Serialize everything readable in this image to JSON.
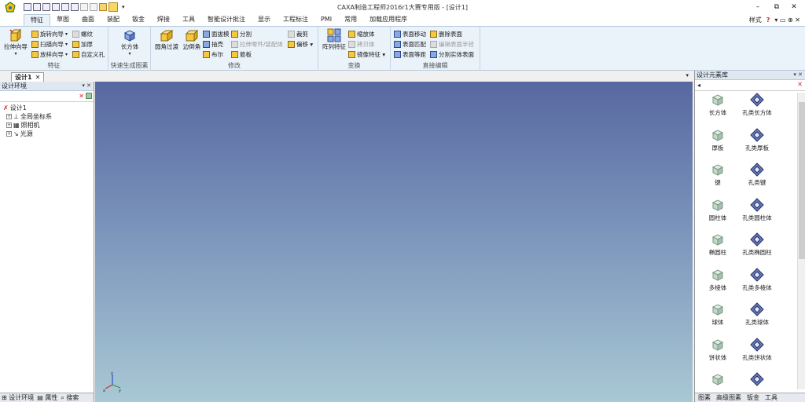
{
  "title": "CAXA制造工程师2016r1大赛专用版 - [设计1]",
  "window_controls": {
    "minimize": "–",
    "maximize": "⧉",
    "close": "✕"
  },
  "menu_tabs": [
    "特征",
    "草图",
    "曲面",
    "装配",
    "钣金",
    "焊接",
    "工具",
    "智能设计批注",
    "显示",
    "工程标注",
    "PMI",
    "常用",
    "加载应用程序"
  ],
  "menu_right": {
    "style": "样式",
    "help": "?",
    "extras": "▾ ▭ ⊕ ✕"
  },
  "ribbon": {
    "group_feature": {
      "label": "特征",
      "big": "拉伸向导",
      "b1": "旋转向导",
      "b2": "扫描向导",
      "b3": "放样向导",
      "c1": "螺纹",
      "c2": "加厚",
      "c3": "自定义孔"
    },
    "group_quick": {
      "label": "快速生成图素",
      "big": "长方体"
    },
    "group_modify": {
      "label": "修改",
      "big1": "圆角过渡",
      "big2": "边倒角",
      "a1": "面拔模",
      "a2": "抽壳",
      "a3": "布尔",
      "b1": "分割",
      "b2": "拉伸零件/装配体",
      "b3": "筋板",
      "c1": "裁剪",
      "c2": "偏移 ▾"
    },
    "group_transform": {
      "label": "变换",
      "big": "阵列特征",
      "a1": "缩放体",
      "a2": "拷贝体",
      "a3": "镜像特征 ▾"
    },
    "group_direct": {
      "label": "直接编辑",
      "a1": "表面移动",
      "a2": "表面匹配",
      "a3": "表面等距",
      "b1": "删除表面",
      "b2": "编辑表面半径",
      "b3": "分割实体表面"
    }
  },
  "doc_tab": "设计1",
  "left_panel": {
    "title": "设计环境",
    "tree": {
      "root": "设计1",
      "c1": "全局坐标系",
      "c2": "照相机",
      "c3": "光源"
    },
    "bottom": {
      "t1": "设计环境",
      "t2": "属性",
      "t3": "搜索"
    }
  },
  "right_panel": {
    "title": "设计元素库",
    "items": [
      {
        "label": "长方体",
        "icon": "cube-icon"
      },
      {
        "label": "孔类长方体",
        "icon": "hole-cube-icon"
      },
      {
        "label": "厚板",
        "icon": "plate-icon"
      },
      {
        "label": "孔类厚板",
        "icon": "hole-plate-icon"
      },
      {
        "label": "键",
        "icon": "key-icon"
      },
      {
        "label": "孔类键",
        "icon": "hole-key-icon"
      },
      {
        "label": "圆柱体",
        "icon": "cylinder-icon"
      },
      {
        "label": "孔类圆柱体",
        "icon": "hole-cylinder-icon"
      },
      {
        "label": "椭圆柱",
        "icon": "ellipse-cylinder-icon"
      },
      {
        "label": "孔类椭圆柱",
        "icon": "hole-ellipse-cylinder-icon"
      },
      {
        "label": "多棱体",
        "icon": "prism-icon"
      },
      {
        "label": "孔类多棱体",
        "icon": "hole-prism-icon"
      },
      {
        "label": "球体",
        "icon": "sphere-icon"
      },
      {
        "label": "孔类球体",
        "icon": "hole-sphere-icon"
      },
      {
        "label": "饼状体",
        "icon": "pie-icon"
      },
      {
        "label": "孔类饼状体",
        "icon": "hole-pie-icon"
      },
      {
        "label": "",
        "icon": "torus-icon"
      },
      {
        "label": "",
        "icon": "hole-torus-icon"
      }
    ],
    "bottom": {
      "t1": "图素",
      "t2": "高级图素",
      "t3": "钣金",
      "t4": "工具"
    }
  },
  "colors": {
    "accent": "#eaf2fa",
    "viewport_top": "#5768a0",
    "viewport_bottom": "#a9c8d4",
    "close_red": "#e02020"
  }
}
